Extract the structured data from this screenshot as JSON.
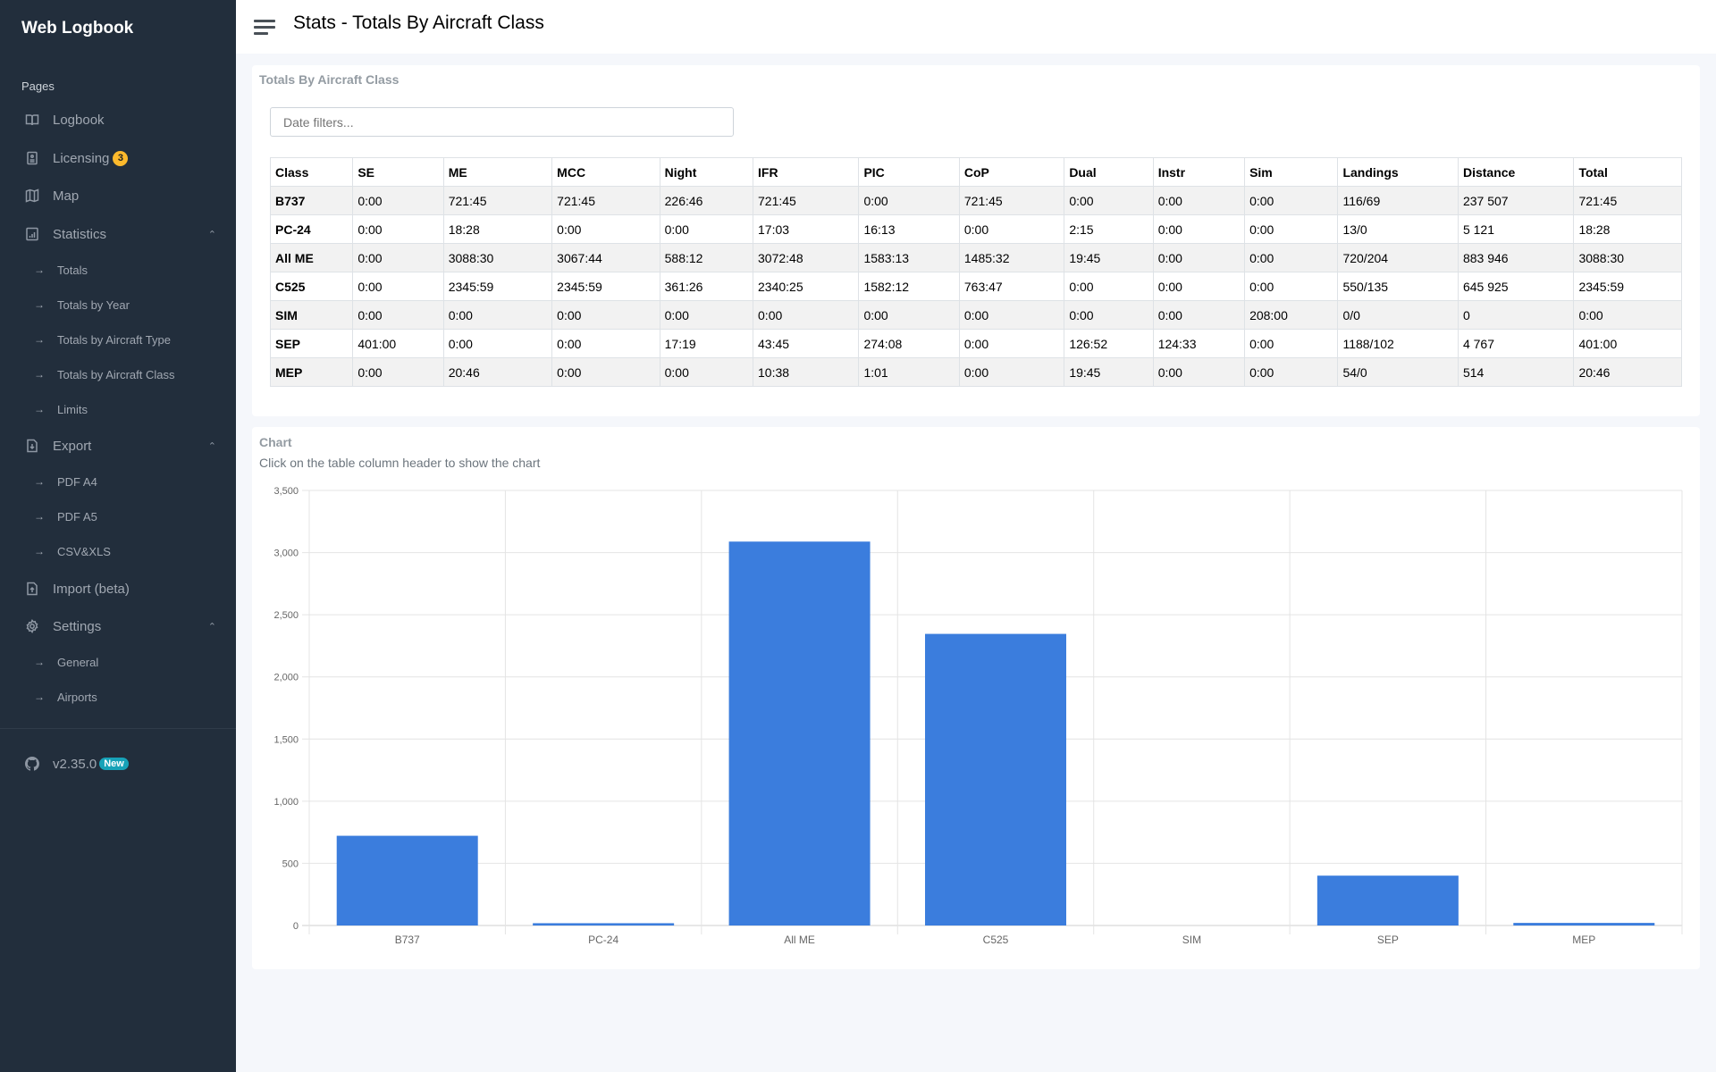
{
  "app": {
    "title": "Web Logbook"
  },
  "sidebar": {
    "header": "Pages",
    "items": [
      {
        "label": "Logbook",
        "icon": "book-icon"
      },
      {
        "label": "Licensing",
        "icon": "license-icon",
        "badge": "3"
      },
      {
        "label": "Map",
        "icon": "map-icon"
      },
      {
        "label": "Statistics",
        "icon": "chart-icon",
        "expanded": true,
        "children": [
          "Totals",
          "Totals by Year",
          "Totals by Aircraft Type",
          "Totals by Aircraft Class",
          "Limits"
        ]
      },
      {
        "label": "Export",
        "icon": "file-download-icon",
        "expanded": true,
        "children": [
          "PDF A4",
          "PDF A5",
          "CSV&XLS"
        ]
      },
      {
        "label": "Import (beta)",
        "icon": "file-upload-icon"
      },
      {
        "label": "Settings",
        "icon": "gear-icon",
        "expanded": true,
        "children": [
          "General",
          "Airports"
        ]
      }
    ],
    "version": {
      "label": "v2.35.0",
      "badge": "New",
      "icon": "github-icon"
    }
  },
  "header": {
    "title": "Stats - Totals By Aircraft Class"
  },
  "totals_card": {
    "title": "Totals By Aircraft Class",
    "date_filter_placeholder": "Date filters...",
    "columns": [
      "Class",
      "SE",
      "ME",
      "MCC",
      "Night",
      "IFR",
      "PIC",
      "CoP",
      "Dual",
      "Instr",
      "Sim",
      "Landings",
      "Distance",
      "Total"
    ],
    "rows": [
      [
        "B737",
        "0:00",
        "721:45",
        "721:45",
        "226:46",
        "721:45",
        "0:00",
        "721:45",
        "0:00",
        "0:00",
        "0:00",
        "116/69",
        "237 507",
        "721:45"
      ],
      [
        "PC-24",
        "0:00",
        "18:28",
        "0:00",
        "0:00",
        "17:03",
        "16:13",
        "0:00",
        "2:15",
        "0:00",
        "0:00",
        "13/0",
        "5 121",
        "18:28"
      ],
      [
        "All ME",
        "0:00",
        "3088:30",
        "3067:44",
        "588:12",
        "3072:48",
        "1583:13",
        "1485:32",
        "19:45",
        "0:00",
        "0:00",
        "720/204",
        "883 946",
        "3088:30"
      ],
      [
        "C525",
        "0:00",
        "2345:59",
        "2345:59",
        "361:26",
        "2340:25",
        "1582:12",
        "763:47",
        "0:00",
        "0:00",
        "0:00",
        "550/135",
        "645 925",
        "2345:59"
      ],
      [
        "SIM",
        "0:00",
        "0:00",
        "0:00",
        "0:00",
        "0:00",
        "0:00",
        "0:00",
        "0:00",
        "0:00",
        "208:00",
        "0/0",
        "0",
        "0:00"
      ],
      [
        "SEP",
        "401:00",
        "0:00",
        "0:00",
        "17:19",
        "43:45",
        "274:08",
        "0:00",
        "126:52",
        "124:33",
        "0:00",
        "1188/102",
        "4 767",
        "401:00"
      ],
      [
        "MEP",
        "0:00",
        "20:46",
        "0:00",
        "0:00",
        "10:38",
        "1:01",
        "0:00",
        "19:45",
        "0:00",
        "0:00",
        "54/0",
        "514",
        "20:46"
      ]
    ]
  },
  "chart_card": {
    "title": "Chart",
    "subtitle": "Click on the table column header to show the chart"
  },
  "colors": {
    "bar": "#3b7ddd",
    "sidebar_bg": "#222e3c",
    "badge_warning": "#fcb92c",
    "badge_info": "#17a2b8"
  },
  "chart_data": {
    "type": "bar",
    "title": "",
    "xlabel": "",
    "ylabel": "",
    "categories": [
      "B737",
      "PC-24",
      "All ME",
      "C525",
      "SIM",
      "SEP",
      "MEP"
    ],
    "values": [
      721.75,
      18.47,
      3088.5,
      2345.98,
      0,
      401,
      20.77
    ],
    "ylim": [
      0,
      3500
    ],
    "yticks": [
      0,
      500,
      1000,
      1500,
      2000,
      2500,
      3000,
      3500
    ],
    "ytick_labels": [
      "0",
      "500",
      "1,000",
      "1,500",
      "2,000",
      "2,500",
      "3,000",
      "3,500"
    ],
    "grid": true,
    "legend": "none"
  }
}
